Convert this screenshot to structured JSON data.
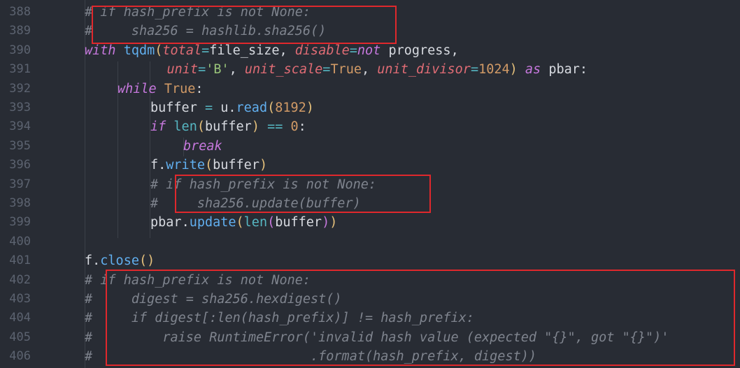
{
  "editor": {
    "lines": [
      {
        "n": "388",
        "tokens": [
          {
            "t": "# if hash_prefix is not None:",
            "c": "cm"
          }
        ],
        "indent": 2
      },
      {
        "n": "389",
        "tokens": [
          {
            "t": "#     sha256 = hashlib.sha256()",
            "c": "cm"
          }
        ],
        "indent": 2
      },
      {
        "n": "390",
        "tokens": [
          {
            "t": "with ",
            "c": "kwi"
          },
          {
            "t": "tqdm",
            "c": "fn"
          },
          {
            "t": "(",
            "c": "gold"
          },
          {
            "t": "total",
            "c": "param"
          },
          {
            "t": "=",
            "c": "op"
          },
          {
            "t": "file_size",
            "c": "pl"
          },
          {
            "t": ", ",
            "c": "pl"
          },
          {
            "t": "disable",
            "c": "param"
          },
          {
            "t": "=",
            "c": "op"
          },
          {
            "t": "not ",
            "c": "kwi"
          },
          {
            "t": "progress",
            "c": "pl"
          },
          {
            "t": ",",
            "c": "pl"
          }
        ],
        "indent": 2
      },
      {
        "n": "391",
        "tokens": [
          {
            "t": "unit",
            "c": "param"
          },
          {
            "t": "=",
            "c": "op"
          },
          {
            "t": "'B'",
            "c": "str"
          },
          {
            "t": ", ",
            "c": "pl"
          },
          {
            "t": "unit_scale",
            "c": "param"
          },
          {
            "t": "=",
            "c": "op"
          },
          {
            "t": "True",
            "c": "num"
          },
          {
            "t": ", ",
            "c": "pl"
          },
          {
            "t": "unit_divisor",
            "c": "param"
          },
          {
            "t": "=",
            "c": "op"
          },
          {
            "t": "1024",
            "c": "num"
          },
          {
            "t": ") ",
            "c": "gold"
          },
          {
            "t": "as ",
            "c": "kwi"
          },
          {
            "t": "pbar",
            "c": "pl"
          },
          {
            "t": ":",
            "c": "pl"
          }
        ],
        "indent": 4.5
      },
      {
        "n": "392",
        "tokens": [
          {
            "t": "while ",
            "c": "kwi"
          },
          {
            "t": "True",
            "c": "num"
          },
          {
            "t": ":",
            "c": "pl"
          }
        ],
        "indent": 3
      },
      {
        "n": "393",
        "tokens": [
          {
            "t": "buffer ",
            "c": "pl"
          },
          {
            "t": "= ",
            "c": "op"
          },
          {
            "t": "u",
            "c": "pl"
          },
          {
            "t": ".",
            "c": "pl"
          },
          {
            "t": "read",
            "c": "fn"
          },
          {
            "t": "(",
            "c": "gold"
          },
          {
            "t": "8192",
            "c": "num"
          },
          {
            "t": ")",
            "c": "gold"
          }
        ],
        "indent": 4
      },
      {
        "n": "394",
        "tokens": [
          {
            "t": "if ",
            "c": "kwi"
          },
          {
            "t": "len",
            "c": "bi"
          },
          {
            "t": "(",
            "c": "gold"
          },
          {
            "t": "buffer",
            "c": "pl"
          },
          {
            "t": ") ",
            "c": "gold"
          },
          {
            "t": "== ",
            "c": "op"
          },
          {
            "t": "0",
            "c": "num"
          },
          {
            "t": ":",
            "c": "pl"
          }
        ],
        "indent": 4
      },
      {
        "n": "395",
        "tokens": [
          {
            "t": "break",
            "c": "kwi"
          }
        ],
        "indent": 5
      },
      {
        "n": "396",
        "tokens": [
          {
            "t": "f",
            "c": "pl"
          },
          {
            "t": ".",
            "c": "pl"
          },
          {
            "t": "write",
            "c": "fn"
          },
          {
            "t": "(",
            "c": "gold"
          },
          {
            "t": "buffer",
            "c": "pl"
          },
          {
            "t": ")",
            "c": "gold"
          }
        ],
        "indent": 4
      },
      {
        "n": "397",
        "tokens": [
          {
            "t": "# if hash_prefix is not None:",
            "c": "cm"
          }
        ],
        "indent": 4
      },
      {
        "n": "398",
        "tokens": [
          {
            "t": "#     sha256.update(buffer)",
            "c": "cm"
          }
        ],
        "indent": 4
      },
      {
        "n": "399",
        "tokens": [
          {
            "t": "pbar",
            "c": "pl"
          },
          {
            "t": ".",
            "c": "pl"
          },
          {
            "t": "update",
            "c": "fn"
          },
          {
            "t": "(",
            "c": "gold"
          },
          {
            "t": "len",
            "c": "bi"
          },
          {
            "t": "(",
            "c": "kw"
          },
          {
            "t": "buffer",
            "c": "pl"
          },
          {
            "t": ")",
            "c": "kw"
          },
          {
            "t": ")",
            "c": "gold"
          }
        ],
        "indent": 4
      },
      {
        "n": "400",
        "tokens": [],
        "indent": 2
      },
      {
        "n": "401",
        "tokens": [
          {
            "t": "f",
            "c": "pl"
          },
          {
            "t": ".",
            "c": "pl"
          },
          {
            "t": "close",
            "c": "fn"
          },
          {
            "t": "()",
            "c": "gold"
          }
        ],
        "indent": 2
      },
      {
        "n": "402",
        "tokens": [
          {
            "t": "# if hash_prefix is not None:",
            "c": "cm"
          }
        ],
        "indent": 2
      },
      {
        "n": "403",
        "tokens": [
          {
            "t": "#     digest = sha256.hexdigest()",
            "c": "cm"
          }
        ],
        "indent": 2
      },
      {
        "n": "404",
        "tokens": [
          {
            "t": "#     if digest[:len(hash_prefix)] != hash_prefix:",
            "c": "cm"
          }
        ],
        "indent": 2
      },
      {
        "n": "405",
        "tokens": [
          {
            "t": "#         raise RuntimeError('invalid hash value (expected \"{}\", got \"{}\")'",
            "c": "cm"
          }
        ],
        "indent": 2
      },
      {
        "n": "406",
        "tokens": [
          {
            "t": "#                            .format(hash_prefix, digest))",
            "c": "cm"
          }
        ],
        "indent": 2
      }
    ]
  },
  "colors": {
    "background": "#282c34",
    "highlight_box": "#e0282c",
    "comment": "#7f848e",
    "keyword": "#c678dd",
    "function": "#61afef"
  }
}
